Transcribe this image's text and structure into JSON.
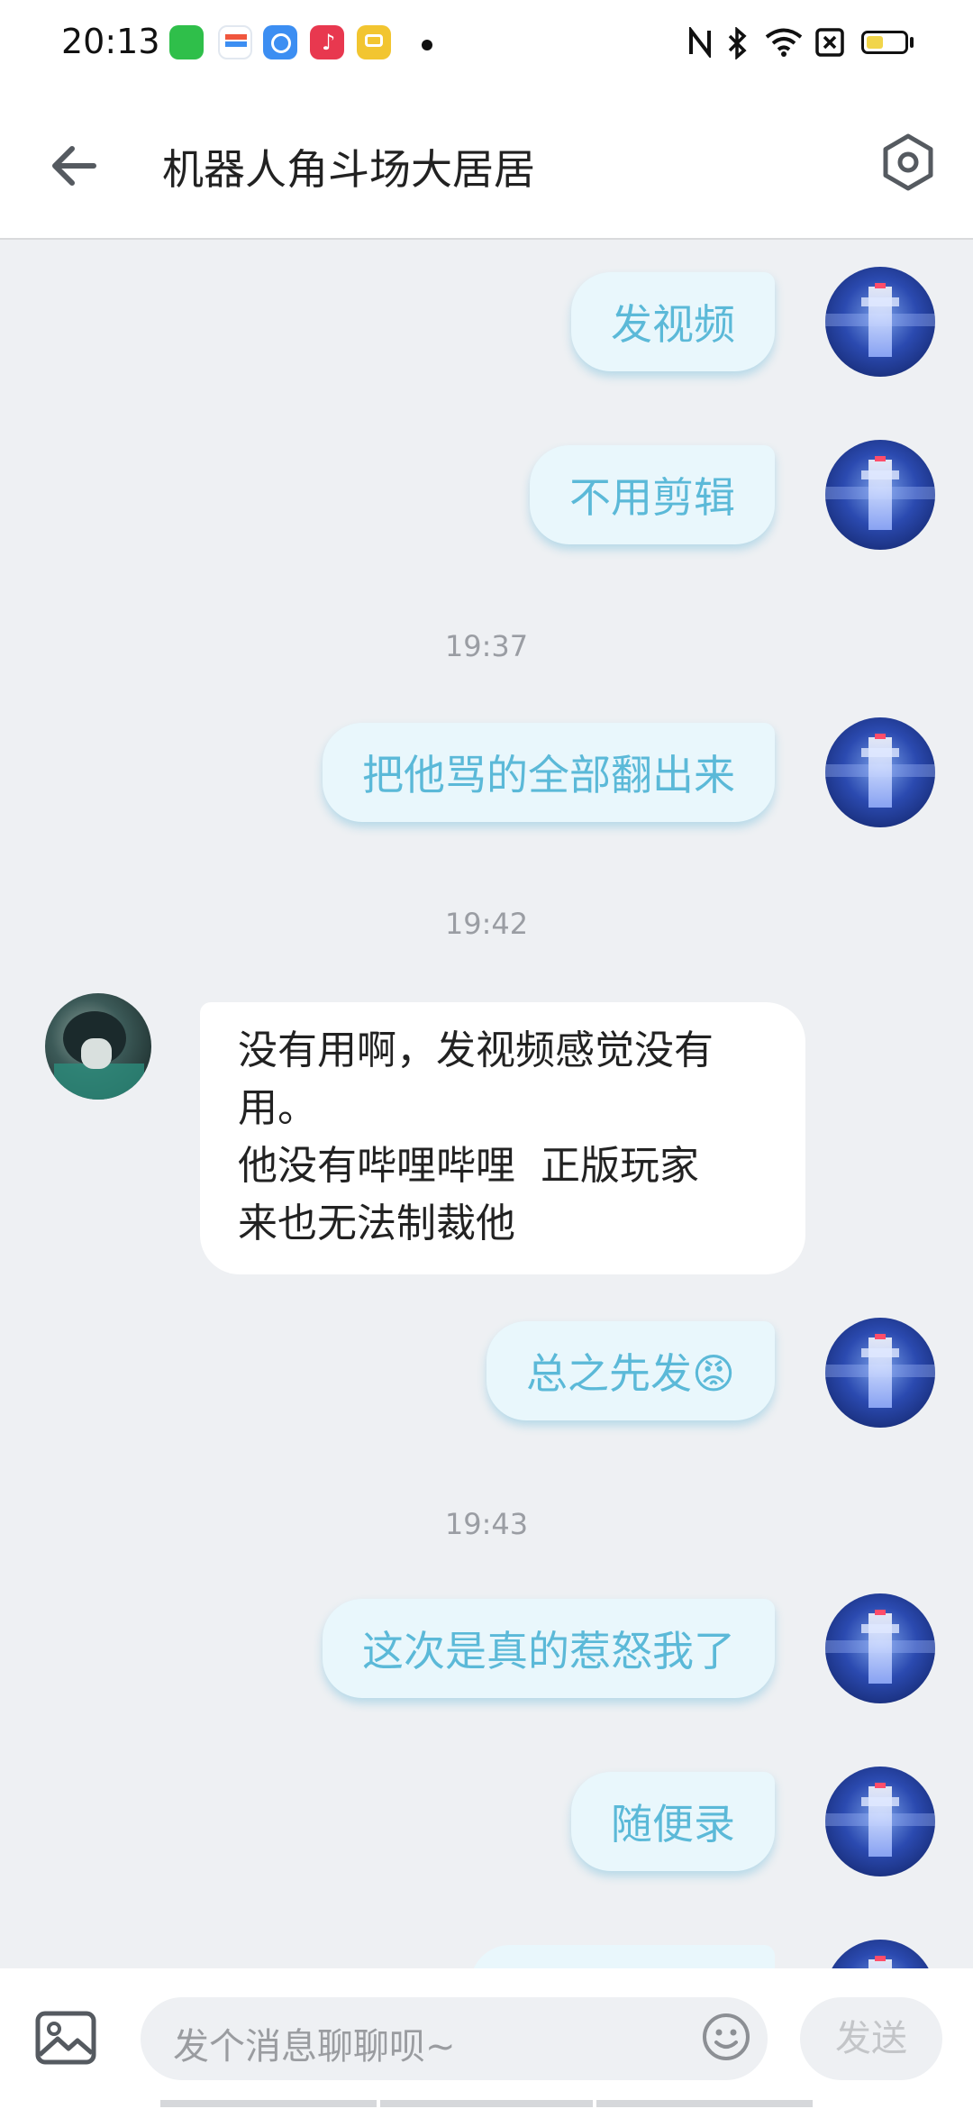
{
  "status_bar": {
    "time": "20:13",
    "app_icons": [
      {
        "name": "app-store-icon",
        "color": "#2fbf4a"
      },
      {
        "name": "wallet-icon",
        "color": "#e9f1fb"
      },
      {
        "name": "browser-icon",
        "color": "#3c8ef2"
      },
      {
        "name": "music-icon",
        "color": "#e8384f"
      },
      {
        "name": "rewards-icon",
        "color": "#f2c530"
      }
    ],
    "battery_fraction": 0.45
  },
  "header": {
    "title": "机器人角斗场大居居"
  },
  "messages": [
    {
      "type": "out",
      "text": "发视频"
    },
    {
      "type": "out",
      "text": "不用剪辑"
    },
    {
      "type": "time",
      "text": "19:37"
    },
    {
      "type": "out",
      "text": "把他骂的全部翻出来"
    },
    {
      "type": "time",
      "text": "19:42"
    },
    {
      "type": "in",
      "lines": [
        "没有用啊，发视频感觉没有",
        "用。",
        "他没有哔哩哔哩  正版玩家",
        "来也无法制裁他"
      ]
    },
    {
      "type": "out",
      "text": "总之先发😡"
    },
    {
      "type": "time",
      "text": "19:43"
    },
    {
      "type": "out",
      "text": "这次是真的惹怒我了"
    },
    {
      "type": "out",
      "text": "随便录"
    }
  ],
  "input_bar": {
    "placeholder": "发个消息聊聊呗~",
    "send_label": "发送"
  },
  "colors": {
    "outgoing_bubble": "#e9f7fc",
    "outgoing_text": "#5bb9d8",
    "background": "#eef0f3"
  }
}
